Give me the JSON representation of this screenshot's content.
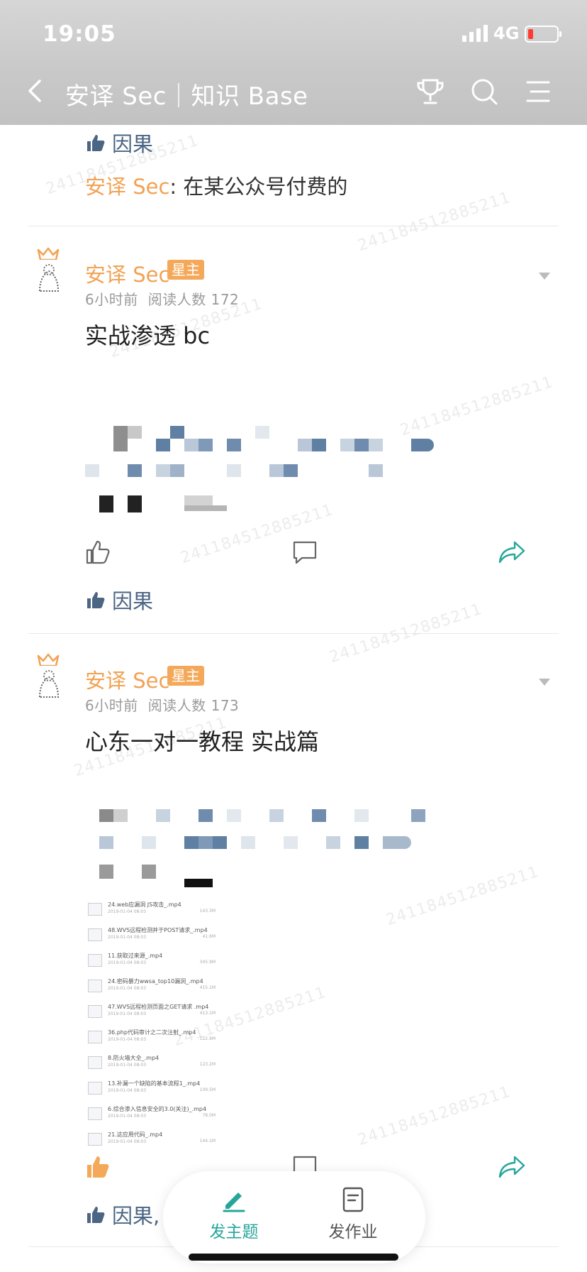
{
  "status_bar": {
    "time": "19:05",
    "network": "4G"
  },
  "header": {
    "title": "安译 Sec｜知识 Base"
  },
  "top_snippet": {
    "like_users": "因果",
    "comment_author": "安译 Sec",
    "comment_text": ": 在某公众号付费的"
  },
  "posts": [
    {
      "author": "安译 Sec",
      "role": "星主",
      "time_ago": "6小时前",
      "reads": "阅读人数 172",
      "title": "实战渗透 bc",
      "like_users": "因果"
    },
    {
      "author": "安译 Sec",
      "role": "星主",
      "time_ago": "6小时前",
      "reads": "阅读人数 173",
      "title": "心东一对一教程 实战篇",
      "like_users": "因果,",
      "files": [
        {
          "name": "24.web应漏洞 JS攻击_.mp4",
          "date": "2019-01-04 08:03",
          "size": "143.3M"
        },
        {
          "name": "48.WVS远程检测并于POST请求_.mp4",
          "date": "2019-01-04 08:03",
          "size": "41.6M"
        },
        {
          "name": "11.获取过来源_.mp4",
          "date": "2019-01-04 08:03",
          "size": "345.9M"
        },
        {
          "name": "24.密码暴力wwsa_top10漏洞_.mp4",
          "date": "2019-01-04 08:03",
          "size": "415.1M"
        },
        {
          "name": "47.WVS远程检测页面之GET请求 .mp4",
          "date": "2019-01-04 08:03",
          "size": "413.1M"
        },
        {
          "name": "36.php代码审计之二次注射_.mp4",
          "date": "2019-01-04 08:03",
          "size": "122.9M"
        },
        {
          "name": "8.防火墙大全_.mp4",
          "date": "2019-01-04 08:03",
          "size": "123.2M"
        },
        {
          "name": "13.补漏一个缺陷的基本流程1_.mp4",
          "date": "2019-01-04 08:03",
          "size": "109.5M"
        },
        {
          "name": "6.综合渗入信息安全的3.0(关注)_.mp4",
          "date": "2019-01-04 08:03",
          "size": "78.0M"
        },
        {
          "name": "21.这应用代码_.mp4",
          "date": "2019-01-04 08:03",
          "size": "144.1M"
        }
      ]
    }
  ],
  "bottom_bar": {
    "publish_topic": "发主题",
    "publish_homework": "发作业"
  },
  "watermark": "241184512885211",
  "colors": {
    "accent": "#f2a253",
    "green": "#26a69a",
    "link_blue": "#4b6584"
  }
}
